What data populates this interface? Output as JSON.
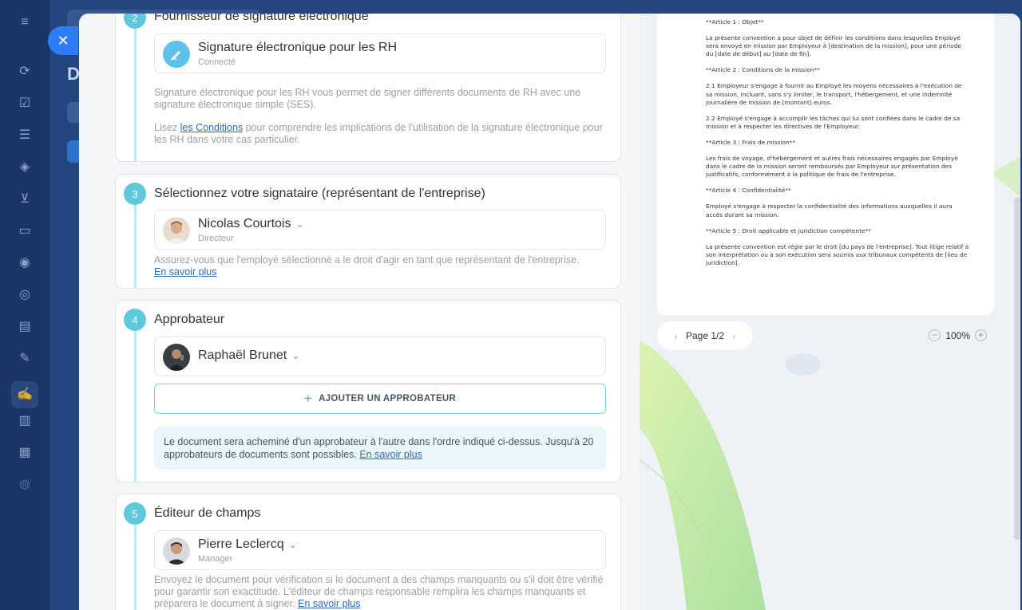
{
  "background": {
    "title_letter": "D"
  },
  "close_label": "✕",
  "steps": [
    {
      "number": "2",
      "title": "Fournisseur de signature électronique",
      "provider": {
        "name": "Signature électronique pour les RH",
        "status": "Connecté"
      },
      "desc1": "Signature électronique pour les RH vous permet de signer différents documents de RH avec une signature électronique simple (SES).",
      "desc2_pre": "Lisez ",
      "desc2_link": "les Conditions",
      "desc2_post": " pour comprendre les implications de l'utilisation de la signature électronique pour les RH dans votre cas particulier."
    },
    {
      "number": "3",
      "title": "Sélectionnez votre signataire (représentant de l'entreprise)",
      "person": {
        "name": "Nicolas Courtois",
        "role": "Directeur"
      },
      "desc": "Assurez-vous que l'employé sélectionné a le droit d'agir en tant que représentant de l'entreprise.",
      "link": "En savoir plus"
    },
    {
      "number": "4",
      "title": "Approbateur",
      "person": {
        "name": "Raphaël Brunet"
      },
      "add_label": "AJOUTER UN APPROBATEUR",
      "info": "Le document sera acheminé d'un approbateur à l'autre dans l'ordre indiqué ci-dessus. Jusqu'à 20 approbateurs de documents sont possibles.",
      "link": "En savoir plus"
    },
    {
      "number": "5",
      "title": "Éditeur de champs",
      "person": {
        "name": "Pierre Leclercq",
        "role": "Manager"
      },
      "desc": "Envoyez le document pour vérification si le document a des champs manquants ou s'il doit être vérifié pour garantir son exactitude. L'éditeur de champs responsable remplira les champs manquants et préparera le document à signer.",
      "link": "En savoir plus"
    }
  ],
  "document": {
    "paragraphs": [
      "**Article 1 : Objet**",
      "La présente convention a pour objet de définir les conditions dans lesquelles Employé sera envoyé en mission par Employeur à [destination de la mission], pour une période du [date de début] au [date de fin].",
      "**Article 2 : Conditions de la mission**",
      "2.1 Employeur s'engage à fournir au Employé les moyens nécessaires à l'exécution de sa mission, incluant, sans s'y limiter, le transport, l'hébergement, et une indemnité journalière de mission de [montant] euros.",
      "2.2 Employé s'engage à accomplir les tâches qui lui sont confiées dans le cadre de sa mission et à respecter les directives de l'Employeur.",
      "**Article 3 : Frais de mission**",
      "Les frais de voyage, d'hébergement et autres frais nécessaires engagés par Employé dans le cadre de la mission seront remboursés par Employeur sur présentation des justificatifs, conformément à la politique de frais de l'entreprise.",
      "**Article 4 : Confidentialité**",
      "Employé s'engage à respecter la confidentialité des informations auxquelles il aura accès durant sa mission.",
      "**Article 5 : Droit applicable et juridiction compétente**",
      "La présente convention est régie par le droit [du pays de l'entreprise]. Tout litige relatif à son interprétation ou à son exécution sera soumis aux tribunaux compétents de [lieu de juridiction]."
    ],
    "page": "Page 1/2",
    "zoom": "100%"
  }
}
